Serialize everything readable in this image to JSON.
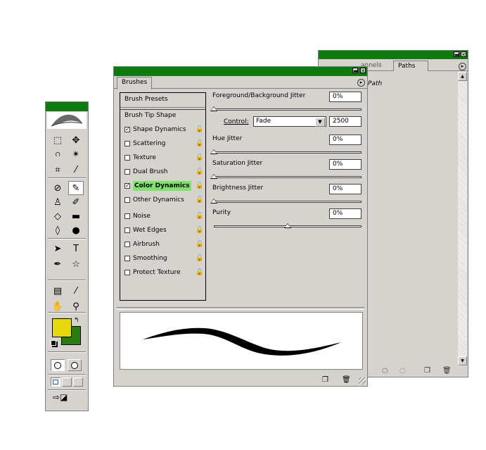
{
  "toolbox": {
    "fg_color": "#e5d80d",
    "bg_color": "#2c7a12",
    "tools": [
      {
        "name": "marquee-tool-icon",
        "glyph": "⬚"
      },
      {
        "name": "move-tool-icon",
        "glyph": "✥"
      },
      {
        "name": "lasso-tool-icon",
        "glyph": "ဂ"
      },
      {
        "name": "magic-wand-tool-icon",
        "glyph": "✴"
      },
      {
        "name": "crop-tool-icon",
        "glyph": "⌗"
      },
      {
        "name": "slice-tool-icon",
        "glyph": "⁄"
      },
      {
        "name": "healing-brush-tool-icon",
        "glyph": "⊘"
      },
      {
        "name": "brush-tool-icon",
        "glyph": "✎"
      },
      {
        "name": "clone-stamp-tool-icon",
        "glyph": "♙"
      },
      {
        "name": "history-brush-tool-icon",
        "glyph": "✐"
      },
      {
        "name": "eraser-tool-icon",
        "glyph": "◇"
      },
      {
        "name": "gradient-tool-icon",
        "glyph": "▬"
      },
      {
        "name": "blur-tool-icon",
        "glyph": "◊"
      },
      {
        "name": "dodge-tool-icon",
        "glyph": "●"
      },
      {
        "name": "path-selection-tool-icon",
        "glyph": "➤"
      },
      {
        "name": "type-tool-icon",
        "glyph": "T"
      },
      {
        "name": "pen-tool-icon",
        "glyph": "✒"
      },
      {
        "name": "shape-tool-icon",
        "glyph": "☆"
      },
      {
        "name": "notes-tool-icon",
        "glyph": "▤"
      },
      {
        "name": "eyedropper-tool-icon",
        "glyph": "⁄"
      },
      {
        "name": "hand-tool-icon",
        "glyph": "✋"
      },
      {
        "name": "zoom-tool-icon",
        "glyph": "⚲"
      }
    ]
  },
  "paths_panel": {
    "tabs": [
      "Channels",
      "Paths"
    ],
    "tab_fragment": "annels",
    "active_tab": "Paths",
    "path_item": "Path"
  },
  "brushes": {
    "tab": "Brushes",
    "presets_label": "Brush Presets",
    "tip_shape_label": "Brush Tip Shape",
    "items": [
      {
        "label": "Shape Dynamics",
        "checked": true,
        "selected": false
      },
      {
        "label": "Scattering",
        "checked": false,
        "selected": false
      },
      {
        "label": "Texture",
        "checked": false,
        "selected": false
      },
      {
        "label": "Dual Brush",
        "checked": false,
        "selected": false
      },
      {
        "label": "Color Dynamics",
        "checked": true,
        "selected": true
      },
      {
        "label": "Other Dynamics",
        "checked": false,
        "selected": false
      },
      {
        "label": "Noise",
        "checked": false,
        "selected": false
      },
      {
        "label": "Wet Edges",
        "checked": false,
        "selected": false
      },
      {
        "label": "Airbrush",
        "checked": false,
        "selected": false
      },
      {
        "label": "Smoothing",
        "checked": false,
        "selected": false
      },
      {
        "label": "Protect Texture",
        "checked": false,
        "selected": false
      }
    ],
    "fg_bg_jitter": {
      "label": "Foreground/Background Jitter",
      "value": "0%",
      "level": 0
    },
    "control": {
      "label": "Control:",
      "value": "Fade",
      "steps": "2500"
    },
    "hue_jitter": {
      "label": "Hue Jitter",
      "value": "0%",
      "level": 0
    },
    "saturation_jitter": {
      "label": "Saturation Jitter",
      "value": "0%",
      "level": 0
    },
    "brightness_jitter": {
      "label": "Brightness Jitter",
      "value": "0%",
      "level": 0
    },
    "purity": {
      "label": "Purity",
      "value": "0%",
      "level": 0.5
    },
    "highlight_color": "#7ee36a"
  }
}
